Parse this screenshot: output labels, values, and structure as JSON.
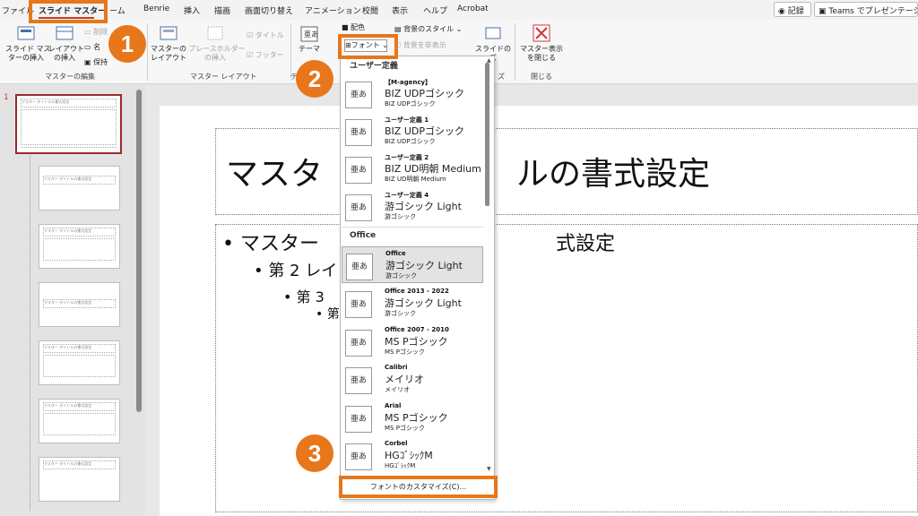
{
  "menubar": {
    "tabs": [
      "ファイル",
      "スライド マスター",
      "ーム",
      "Benrie",
      "挿入",
      "描画",
      "画面切り替え",
      "アニメーション",
      "校閲",
      "表示",
      "ヘルプ",
      "Acrobat"
    ],
    "record_label": "記録",
    "teams_label": "Teams でプレゼンテーシ"
  },
  "ribbon": {
    "insert_slide_master": "スライド マス\nターの挿入",
    "insert_layout": "レイアウト\nの挿入",
    "delete_short": "削除",
    "rename_short": "名",
    "preserve_short": "保持",
    "master_layout": "マスターの\nレイアウト",
    "insert_placeholder": "プレースホルダー\nの挿入",
    "title_check": "タイトル",
    "footer_check": "フッター",
    "theme": "テーマ",
    "colors_short": "配色",
    "fonts_button": "フォント",
    "background_styles": "背景のスタイル",
    "hide_background": "背景を非表示",
    "slide_size": "スライドの\nズ",
    "close_master": "マスター表示\nを閉じる",
    "groups": {
      "edit_master": "マスターの編集",
      "master_layout": "マスター レイアウト",
      "edit_theme_short": "テ",
      "size_short": "ズ",
      "close": "閉じる"
    }
  },
  "thumbnails": {
    "slide_number": "1",
    "thumb_title": "マスター タイトルの書式設定"
  },
  "slide": {
    "title": "マスタ　　　　　　ルの書式設定",
    "level1": "• マスター　　　　　　　　　　　　式設定",
    "level2": "• 第 2 レイ",
    "level3": "• 第 3",
    "level4": "• 第"
  },
  "font_dropdown": {
    "section_user": "ユーザー定義",
    "section_office": "Office",
    "aa_glyph": "亜あ",
    "user_items": [
      {
        "name": "【M-agency】",
        "heading": "BIZ UDPゴシック",
        "body": "BIZ UDPゴシック"
      },
      {
        "name": "ユーザー定義 1",
        "heading": "BIZ UDPゴシック",
        "body": "BIZ UDPゴシック"
      },
      {
        "name": "ユーザー定義 2",
        "heading": "BIZ UD明朝 Medium",
        "body": "BIZ UD明朝 Medium"
      },
      {
        "name": "ユーザー定義 4",
        "heading": "游ゴシック Light",
        "body": "游ゴシック"
      }
    ],
    "office_items": [
      {
        "name": "Office",
        "heading": "游ゴシック Light",
        "body": "游ゴシック"
      },
      {
        "name": "Office 2013 - 2022",
        "heading": "游ゴシック Light",
        "body": "游ゴシック"
      },
      {
        "name": "Office 2007 - 2010",
        "heading": "MS Pゴシック",
        "body": "MS Pゴシック"
      },
      {
        "name": "Calibri",
        "heading": "メイリオ",
        "body": "メイリオ"
      },
      {
        "name": "Arial",
        "heading": "MS Pゴシック",
        "body": "MS Pゴシック"
      },
      {
        "name": "Corbel",
        "heading": "HGｺﾞｼｯｸM",
        "body": "HGｺﾞｼｯｸM"
      }
    ],
    "customize_label": "フォントのカスタマイズ(C)..."
  },
  "steps": [
    "1",
    "2",
    "3"
  ],
  "colors": {
    "accent_orange": "#e8761a",
    "tab_underline": "#c43e1c"
  }
}
